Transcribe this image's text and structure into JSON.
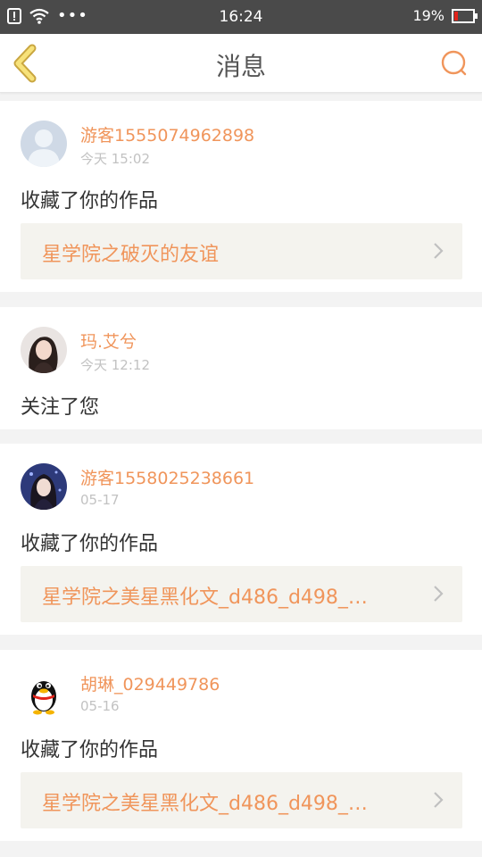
{
  "status_bar": {
    "time": "16:24",
    "battery_percent_label": "19%",
    "battery_level": 0.19,
    "more_dots": "•••"
  },
  "nav": {
    "title": "消息"
  },
  "colors": {
    "accent": "#f0955b",
    "back_icon_fill": "#f7e27a",
    "back_icon_stroke": "#c9a640",
    "battery_low": "#e2231a"
  },
  "messages": [
    {
      "user": "游客1555074962898",
      "time": "今天 15:02",
      "action": "收藏了你的作品",
      "work": "星学院之破灭的友谊",
      "avatar": "default-avatar"
    },
    {
      "user": "玛.艾兮",
      "time": "今天 12:12",
      "action": "关注了您",
      "avatar": "photo-avatar"
    },
    {
      "user": "游客1558025238661",
      "time": "05-17",
      "action": "收藏了你的作品",
      "work": "星学院之美星黑化文_d486_d498_…",
      "avatar": "photo-avatar"
    },
    {
      "user": "胡琳_029449786",
      "time": "05-16",
      "action": "收藏了你的作品",
      "work": "星学院之美星黑化文_d486_d498_…",
      "avatar": "penguin-avatar"
    }
  ]
}
